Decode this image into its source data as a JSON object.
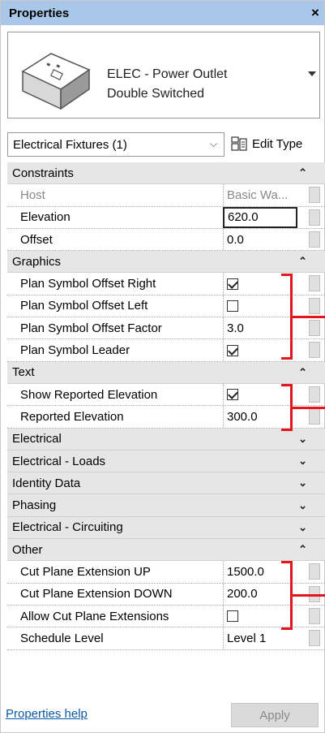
{
  "window": {
    "title": "Properties",
    "close_glyph": "×"
  },
  "type_selector": {
    "line1": "ELEC - Power Outlet",
    "line2": "Double Switched"
  },
  "filter": {
    "label": "Electrical Fixtures (1)",
    "edit_type": "Edit Type"
  },
  "rows": [
    {
      "kind": "group",
      "label": "Constraints",
      "toggle": "⌃"
    },
    {
      "kind": "prop",
      "name": "Host",
      "value": "Basic Wa...",
      "grey": true
    },
    {
      "kind": "prop",
      "name": "Elevation",
      "value": "620.0",
      "editing": true
    },
    {
      "kind": "prop",
      "name": "Offset",
      "value": "0.0"
    },
    {
      "kind": "group",
      "label": "Graphics",
      "toggle": "⌃"
    },
    {
      "kind": "prop",
      "name": "Plan Symbol Offset Right",
      "check": true
    },
    {
      "kind": "prop",
      "name": "Plan Symbol Offset Left",
      "check": false
    },
    {
      "kind": "prop",
      "name": "Plan Symbol Offset Factor",
      "value": "3.0"
    },
    {
      "kind": "prop",
      "name": "Plan Symbol Leader",
      "check": true
    },
    {
      "kind": "group",
      "label": "Text",
      "toggle": "⌃"
    },
    {
      "kind": "prop",
      "name": "Show Reported Elevation",
      "check": true
    },
    {
      "kind": "prop",
      "name": "Reported Elevation",
      "value": "300.0"
    },
    {
      "kind": "group",
      "label": "Electrical",
      "toggle": "⌄"
    },
    {
      "kind": "group",
      "label": "Electrical - Loads",
      "toggle": "⌄"
    },
    {
      "kind": "group",
      "label": "Identity Data",
      "toggle": "⌄"
    },
    {
      "kind": "group",
      "label": "Phasing",
      "toggle": "⌄"
    },
    {
      "kind": "group",
      "label": "Electrical - Circuiting",
      "toggle": "⌄"
    },
    {
      "kind": "group",
      "label": "Other",
      "toggle": "⌃"
    },
    {
      "kind": "prop",
      "name": "Cut Plane Extension UP",
      "value": "1500.0"
    },
    {
      "kind": "prop",
      "name": "Cut Plane Extension DOWN",
      "value": "200.0"
    },
    {
      "kind": "prop",
      "name": "Allow Cut Plane Extensions",
      "check": false
    },
    {
      "kind": "prop",
      "name": "Schedule Level",
      "value": "Level 1"
    }
  ],
  "footer": {
    "help": "Properties help",
    "apply": "Apply"
  },
  "colors": {
    "titlebar": "#a9c7e8",
    "group_bg": "#e6e6e6",
    "highlight": "#e5161b",
    "link": "#0b5aa5"
  },
  "icons": {
    "close": "close-icon",
    "dropdown": "chevron-down-icon",
    "edit_type": "edit-type-icon",
    "thumbnail": "power-outlet-thumbnail"
  }
}
